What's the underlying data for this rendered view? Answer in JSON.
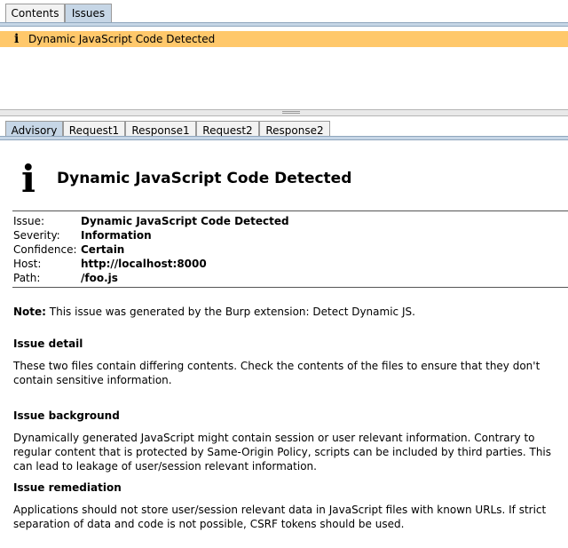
{
  "top_tabs": [
    {
      "label": "Contents",
      "active": false
    },
    {
      "label": "Issues",
      "active": true
    }
  ],
  "issue_list": {
    "icon": "info-icon",
    "selected_issue": "Dynamic JavaScript Code Detected",
    "row_color": "#ffc86b"
  },
  "bottom_tabs": [
    {
      "label": "Advisory",
      "active": true
    },
    {
      "label": "Request1",
      "active": false
    },
    {
      "label": "Response1",
      "active": false
    },
    {
      "label": "Request2",
      "active": false
    },
    {
      "label": "Response2",
      "active": false
    }
  ],
  "advisory": {
    "icon": "info-icon",
    "title": "Dynamic JavaScript Code Detected",
    "properties": [
      {
        "key": "Issue:",
        "value": "Dynamic JavaScript Code Detected"
      },
      {
        "key": "Severity:",
        "value": "Information"
      },
      {
        "key": "Confidence:",
        "value": "Certain"
      },
      {
        "key": "Host:",
        "value": "http://localhost:8000"
      },
      {
        "key": "Path:",
        "value": "/foo.js"
      }
    ],
    "note_label": "Note:",
    "note_text": " This issue was generated by the Burp extension: Detect Dynamic JS.",
    "detail_heading": "Issue detail",
    "detail_text": "These two files contain differing contents. Check the contents of the files to ensure that they don't contain sensitive information.",
    "background_heading": "Issue background",
    "background_text": "Dynamically generated JavaScript might contain session or user relevant information. Contrary to regular content that is protected by Same-Origin Policy, scripts can be included by third parties. This can lead to leakage of user/session relevant information.",
    "remediation_heading": "Issue remediation",
    "remediation_text": "Applications should not store user/session relevant data in JavaScript files with known URLs. If strict separation of data and code is not possible, CSRF tokens should be used."
  }
}
